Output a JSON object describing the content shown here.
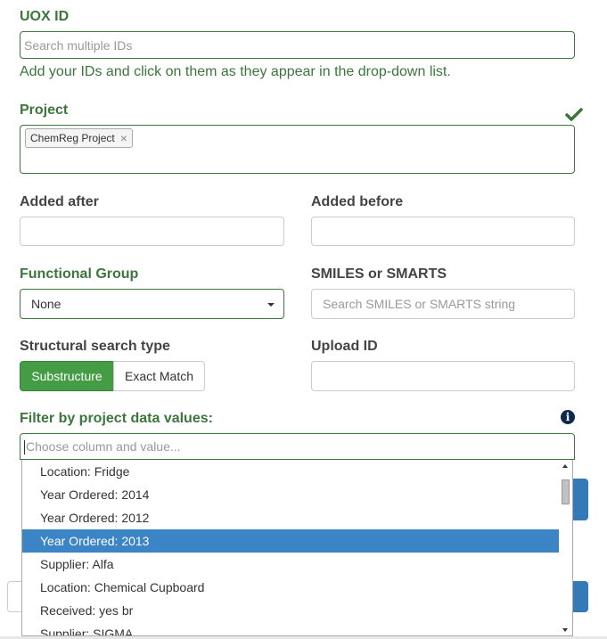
{
  "uox": {
    "label": "UOX ID",
    "placeholder": "Search multiple IDs",
    "help": "Add your IDs and click on them as they appear in the drop-down list."
  },
  "project": {
    "label": "Project",
    "tags": [
      "ChemReg Project"
    ],
    "tag_remove": "×"
  },
  "added_after": {
    "label": "Added after",
    "value": ""
  },
  "added_before": {
    "label": "Added before",
    "value": ""
  },
  "functional_group": {
    "label": "Functional Group",
    "selected": "None"
  },
  "smiles": {
    "label": "SMILES or SMARTS",
    "placeholder": "Search SMILES or SMARTS string"
  },
  "structural_search": {
    "label": "Structural search type",
    "options": [
      "Substructure",
      "Exact Match"
    ],
    "active": "Substructure"
  },
  "upload_id": {
    "label": "Upload ID",
    "value": ""
  },
  "filter": {
    "label": "Filter by project data values:",
    "placeholder": "Choose column and value...",
    "info_icon": "i",
    "options": [
      "Location: Fridge",
      "Year Ordered: 2014",
      "Year Ordered: 2012",
      "Year Ordered: 2013",
      "Supplier: Alfa",
      "Location: Chemical Cupboard",
      "Received: yes br",
      "Supplier: SIGMA"
    ],
    "highlighted": "Year Ordered: 2013"
  },
  "colors": {
    "success": "#3c763d",
    "active_button": "#449d44",
    "highlight": "#3b85c7",
    "primary": "#337ab7"
  },
  "icons": {
    "valid": "checkmark-icon",
    "info": "info-icon",
    "tag_remove": "close-icon",
    "select_caret": "caret-down-icon"
  }
}
